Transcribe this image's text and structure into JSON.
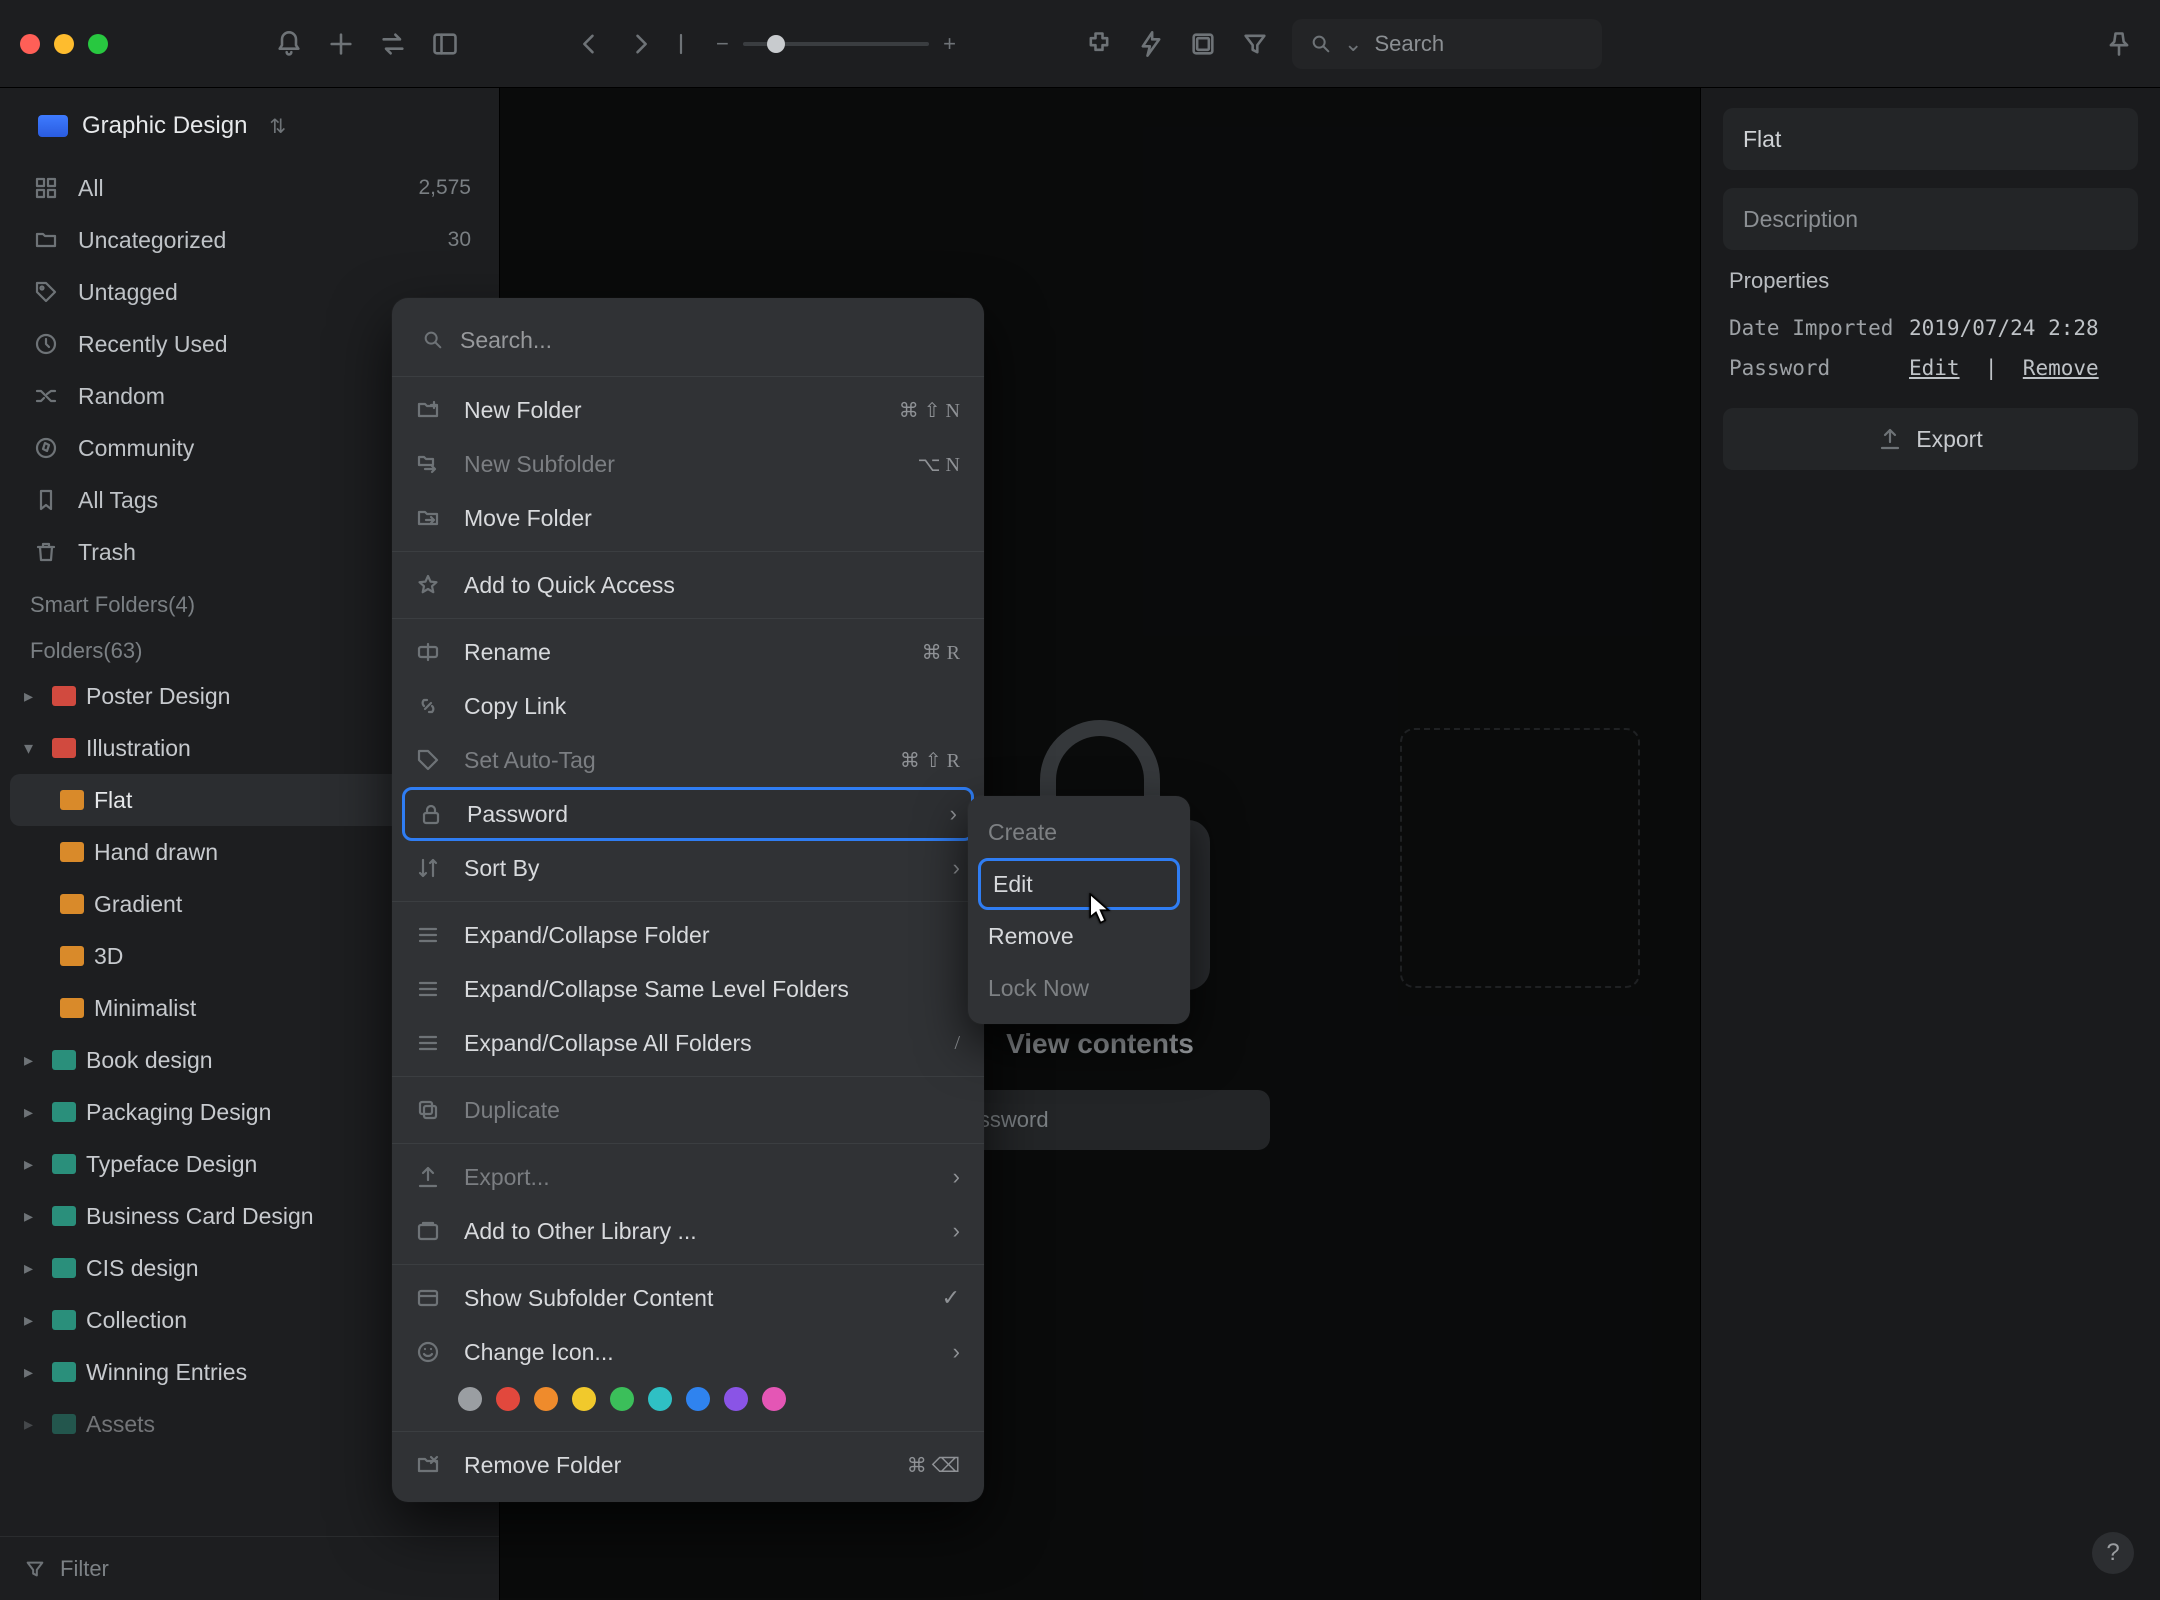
{
  "titlebar": {
    "search_placeholder": "Search"
  },
  "library": {
    "name": "Graphic Design"
  },
  "nav": {
    "all": "All",
    "all_count": "2,575",
    "uncat": "Uncategorized",
    "uncat_count": "30",
    "untagged": "Untagged",
    "recent": "Recently Used",
    "random": "Random",
    "community": "Community",
    "alltags": "All Tags",
    "trash": "Trash"
  },
  "sections": {
    "smart": "Smart Folders(4)",
    "folders": "Folders(63)"
  },
  "tree": {
    "poster": "Poster Design",
    "illustration": "Illustration",
    "flat": "Flat",
    "hand": "Hand drawn",
    "gradient": "Gradient",
    "three_d": "3D",
    "minimal": "Minimalist",
    "book": "Book design",
    "packaging": "Packaging Design",
    "typeface": "Typeface Design",
    "bizcard": "Business Card Design",
    "cis": "CIS design",
    "collection": "Collection",
    "winning": "Winning Entries",
    "assets": "Assets"
  },
  "filter": {
    "label": "Filter"
  },
  "locked": {
    "title": "View contents",
    "placeholder": "Password"
  },
  "inspector": {
    "name_value": "Flat",
    "desc_placeholder": "Description",
    "properties": "Properties",
    "date_imported_k": "Date Imported",
    "date_imported_v": "2019/07/24 2:28",
    "password_k": "Password",
    "password_edit": "Edit",
    "password_remove": "Remove",
    "export": "Export"
  },
  "ctx": {
    "search_placeholder": "Search...",
    "new_folder": "New Folder",
    "new_folder_sc": "⌘ ⇧ N",
    "new_subfolder": "New Subfolder",
    "new_subfolder_sc": "⌥ N",
    "move_folder": "Move Folder",
    "quick": "Add to Quick Access",
    "rename": "Rename",
    "rename_sc": "⌘ R",
    "copylink": "Copy Link",
    "autotag": "Set Auto-Tag",
    "autotag_sc": "⌘ ⇧ R",
    "password": "Password",
    "sortby": "Sort By",
    "expand": "Expand/Collapse Folder",
    "expand_same": "Expand/Collapse Same Level Folders",
    "expand_all": "Expand/Collapse All Folders",
    "expand_all_sc": "/",
    "duplicate": "Duplicate",
    "export": "Export...",
    "addother": "Add to Other Library ...",
    "showsub": "Show Subfolder Content",
    "changeicon": "Change Icon...",
    "remove": "Remove Folder",
    "remove_sc": "⌘ ⌫"
  },
  "submenu": {
    "create": "Create",
    "edit": "Edit",
    "remove": "Remove",
    "locknow": "Lock Now"
  },
  "swatches": [
    "#9a9ea2",
    "#e2483d",
    "#ef8b2c",
    "#f1c92c",
    "#3bbf5a",
    "#2fc0c4",
    "#2f83ef",
    "#8a54e6",
    "#e456b5"
  ]
}
